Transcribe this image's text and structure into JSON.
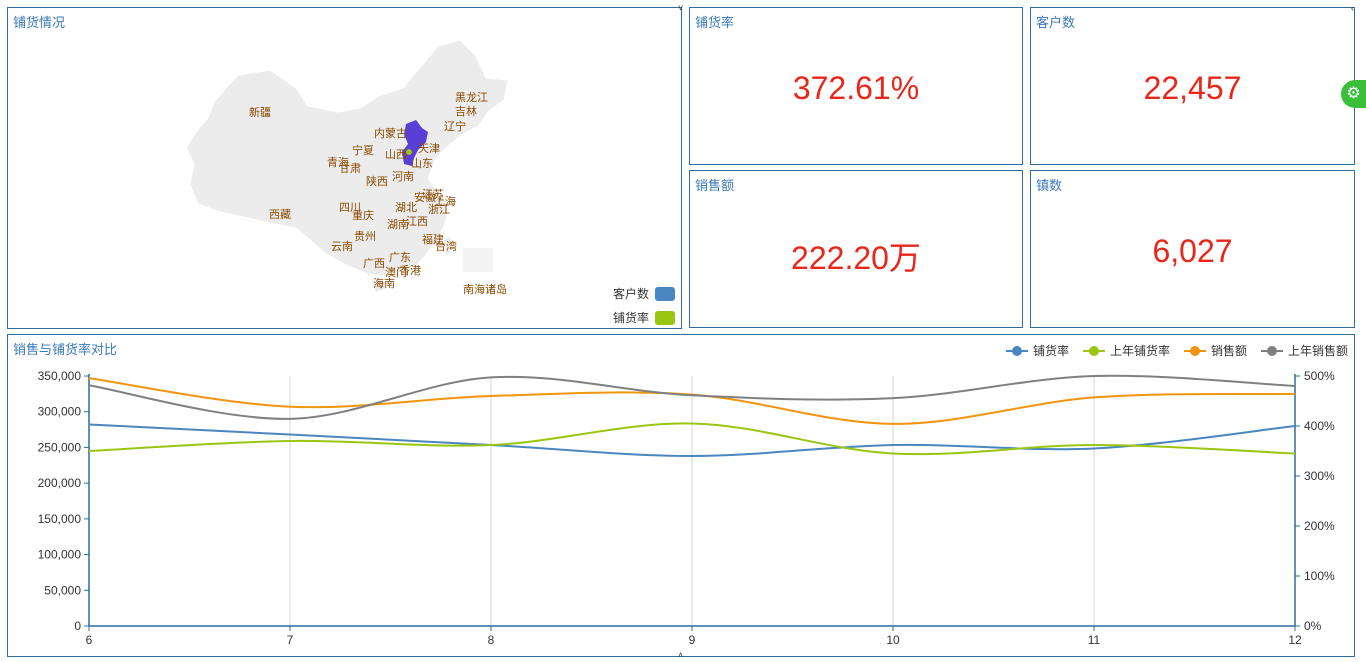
{
  "map": {
    "title": "铺货情况",
    "provinces": [
      {
        "name": "黑龙江"
      },
      {
        "name": "吉林"
      },
      {
        "name": "辽宁"
      },
      {
        "name": "内蒙古"
      },
      {
        "name": "新疆"
      },
      {
        "name": "宁夏"
      },
      {
        "name": "山西"
      },
      {
        "name": "天津"
      },
      {
        "name": "山东"
      },
      {
        "name": "青海"
      },
      {
        "name": "甘肃"
      },
      {
        "name": "陕西"
      },
      {
        "name": "河南"
      },
      {
        "name": "安徽"
      },
      {
        "name": "江苏"
      },
      {
        "name": "上海"
      },
      {
        "name": "浙江"
      },
      {
        "name": "西藏"
      },
      {
        "name": "四川"
      },
      {
        "name": "重庆"
      },
      {
        "name": "湖北"
      },
      {
        "name": "湖南"
      },
      {
        "name": "江西"
      },
      {
        "name": "贵州"
      },
      {
        "name": "云南"
      },
      {
        "name": "福建"
      },
      {
        "name": "台湾"
      },
      {
        "name": "广东"
      },
      {
        "name": "广西"
      },
      {
        "name": "香港"
      },
      {
        "name": "澳门"
      },
      {
        "name": "海南"
      },
      {
        "name": "南海诸岛"
      }
    ],
    "legend": [
      {
        "label": "客户数",
        "color": "#4a86bf"
      },
      {
        "label": "铺货率",
        "color": "#9ac511"
      }
    ]
  },
  "kpis": [
    {
      "title": "铺货率",
      "value": "372.61%"
    },
    {
      "title": "客户数",
      "value": "22,457"
    },
    {
      "title": "销售额",
      "value": "222.20万"
    },
    {
      "title": "镇数",
      "value": "6,027"
    }
  ],
  "chart": {
    "title": "销售与铺货率对比"
  },
  "chart_data": {
    "type": "line",
    "x": [
      6,
      7,
      8,
      9,
      10,
      11,
      12
    ],
    "left_axis": {
      "ylim": [
        0,
        350000
      ],
      "ticks": [
        0,
        50000,
        100000,
        150000,
        200000,
        250000,
        300000,
        350000
      ],
      "tick_labels": [
        "0",
        "50,000",
        "100,000",
        "150,000",
        "200,000",
        "250,000",
        "300,000",
        "350,000"
      ]
    },
    "right_axis": {
      "ylim": [
        0,
        500
      ],
      "ticks": [
        0,
        100,
        200,
        300,
        400,
        500
      ],
      "tick_labels": [
        "0%",
        "100%",
        "200%",
        "300%",
        "400%",
        "500%"
      ]
    },
    "grid": "vertical",
    "legend_position": "top-right",
    "series": [
      {
        "name": "铺货率",
        "axis": "right",
        "color": "#4a86bf",
        "values": [
          403,
          383,
          362,
          340,
          362,
          355,
          400
        ]
      },
      {
        "name": "上年铺货率",
        "axis": "right",
        "color": "#9ac511",
        "values": [
          350,
          370,
          362,
          405,
          345,
          362,
          345
        ]
      },
      {
        "name": "销售额",
        "axis": "left",
        "color": "#f0950e",
        "values": [
          347000,
          307000,
          322000,
          324000,
          283000,
          320000,
          325000
        ]
      },
      {
        "name": "上年销售额",
        "axis": "left",
        "color": "#808080",
        "values": [
          337000,
          290000,
          348000,
          323000,
          319000,
          350000,
          336000
        ]
      }
    ]
  }
}
